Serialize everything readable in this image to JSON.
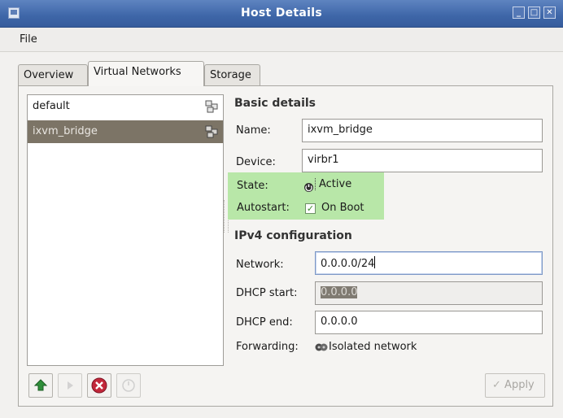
{
  "window": {
    "title": "Host Details"
  },
  "menubar": {
    "file_label": "File"
  },
  "tabs": [
    {
      "label": "Overview"
    },
    {
      "label": "Virtual Networks"
    },
    {
      "label": "Storage"
    }
  ],
  "networks": [
    {
      "name": "default",
      "icon": "network-icon"
    },
    {
      "name": "ixvm_bridge",
      "icon": "network-icon",
      "selected": true
    }
  ],
  "basic": {
    "title": "Basic details",
    "name_label": "Name:",
    "name_value": "ixvm_bridge",
    "device_label": "Device:",
    "device_value": "virbr1",
    "state_label": "State:",
    "state_value": "Active",
    "autostart_label": "Autostart:",
    "autostart_value": "On Boot",
    "autostart_checked": true
  },
  "ipv4": {
    "title": "IPv4 configuration",
    "network_label": "Network:",
    "network_value": "0.0.0.0/24",
    "dhcp_start_label": "DHCP start:",
    "dhcp_start_value": "0.0.0.0",
    "dhcp_end_label": "DHCP end:",
    "dhcp_end_value": "0.0.0.0",
    "forwarding_label": "Forwarding:",
    "forwarding_value": "Isolated network"
  },
  "buttons": {
    "apply_label": "Apply"
  },
  "colors": {
    "titlebar": "#3e66a8",
    "selected_row": "#7c7466",
    "highlight": "#b8e7a8"
  }
}
